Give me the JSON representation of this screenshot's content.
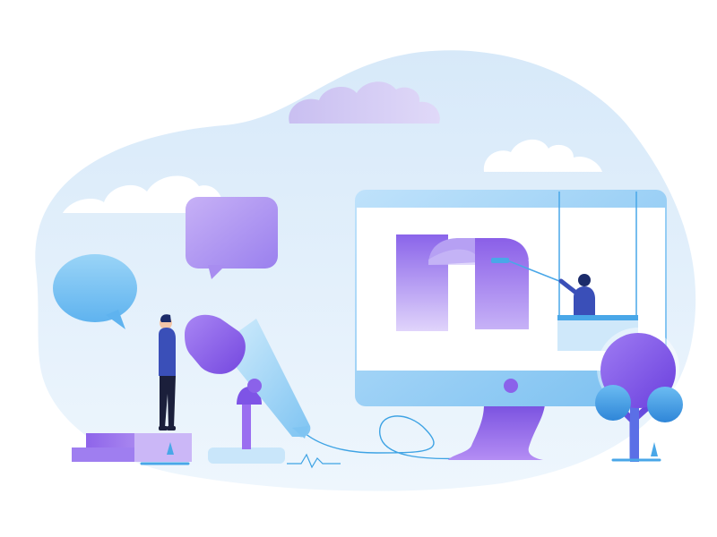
{
  "illustration": {
    "palette": {
      "background": "#ffffff",
      "backdrop_blob": "#e3f0fb",
      "cloud_white": "#ffffff",
      "cloud_lavender": "#cbc4f2",
      "bubble_blue": "#7cc3f3",
      "bubble_purple": "#b69df2",
      "monitor_frame": "#8ec9f2",
      "monitor_screen": "#ffffff",
      "monitor_stand": "#8d63e8",
      "microphone_head": "#9b6ef0",
      "microphone_body": "#8fd0f5",
      "steps": "#a07df0",
      "tree_crown": "#8b62ea",
      "tree_leaves": "#49a7e8",
      "figure_shirt": "#3a4fb8",
      "figure_pants": "#1b1f3b",
      "cable": "#3ea3e4"
    },
    "elements": [
      {
        "name": "backdrop-blob"
      },
      {
        "name": "cloud-lavender"
      },
      {
        "name": "cloud-right"
      },
      {
        "name": "cloud-left"
      },
      {
        "name": "speech-bubble-blue",
        "icon": "speech-bubble-icon"
      },
      {
        "name": "speech-bubble-purple",
        "icon": "speech-bubble-icon"
      },
      {
        "name": "desktop-monitor",
        "icon": "monitor-icon"
      },
      {
        "name": "document-scroll",
        "icon": "document-icon"
      },
      {
        "name": "window-cleaner-person"
      },
      {
        "name": "studio-microphone",
        "icon": "microphone-icon"
      },
      {
        "name": "standing-person"
      },
      {
        "name": "stair-steps"
      },
      {
        "name": "tree",
        "icon": "tree-icon"
      },
      {
        "name": "cable"
      }
    ]
  }
}
